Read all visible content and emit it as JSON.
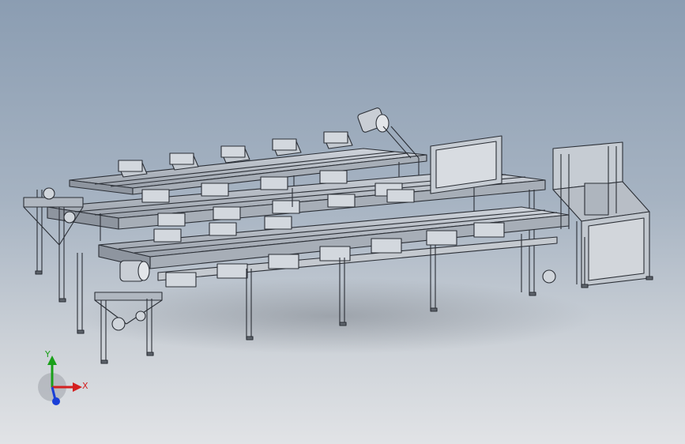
{
  "viewport": {
    "background_top": "#8b9db2",
    "background_bottom": "#e1e3e6",
    "model_line_color": "#2b2f36",
    "model_fill_color": "#b9bfc8",
    "model_dark_color": "#8e959f"
  },
  "triad": {
    "x_label": "X",
    "y_label": "Y",
    "x_color": "#d42020",
    "y_color": "#19a019",
    "z_color": "#1a3fd8"
  }
}
